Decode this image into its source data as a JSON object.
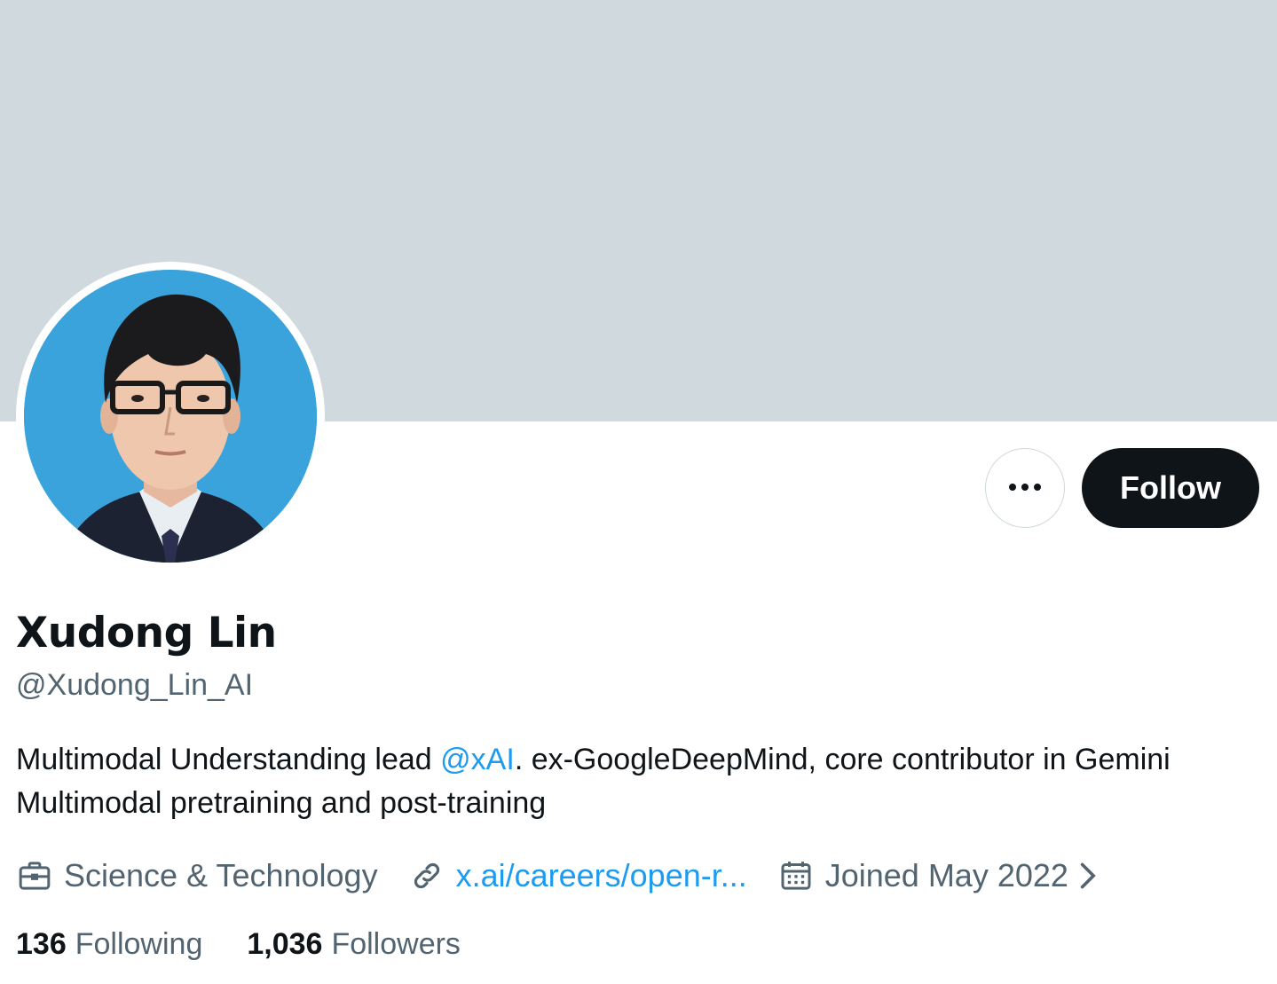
{
  "profile": {
    "display_name": "Xudong Lin",
    "handle": "@Xudong_Lin_AI",
    "bio_before": "Multimodal Understanding lead ",
    "bio_mention": "@xAI",
    "bio_after": ". ex-GoogleDeepMind, core contributor in Gemini Multimodal pretraining and post-training",
    "category": "Science & Technology",
    "website": "x.ai/careers/open-r...",
    "joined": "Joined May 2022"
  },
  "stats": {
    "following_count": "136",
    "following_label": "Following",
    "followers_count": "1,036",
    "followers_label": "Followers"
  },
  "actions": {
    "follow_label": "Follow",
    "more_icon": "more-options-icon"
  },
  "colors": {
    "banner": "#cfd9de",
    "accent": "#1d9bf0",
    "follow_button": "#0f1419",
    "secondary_text": "#536471",
    "avatar_background": "#3aa3dc"
  },
  "icons": [
    "briefcase-icon",
    "link-icon",
    "calendar-icon",
    "chevron-right-icon"
  ]
}
